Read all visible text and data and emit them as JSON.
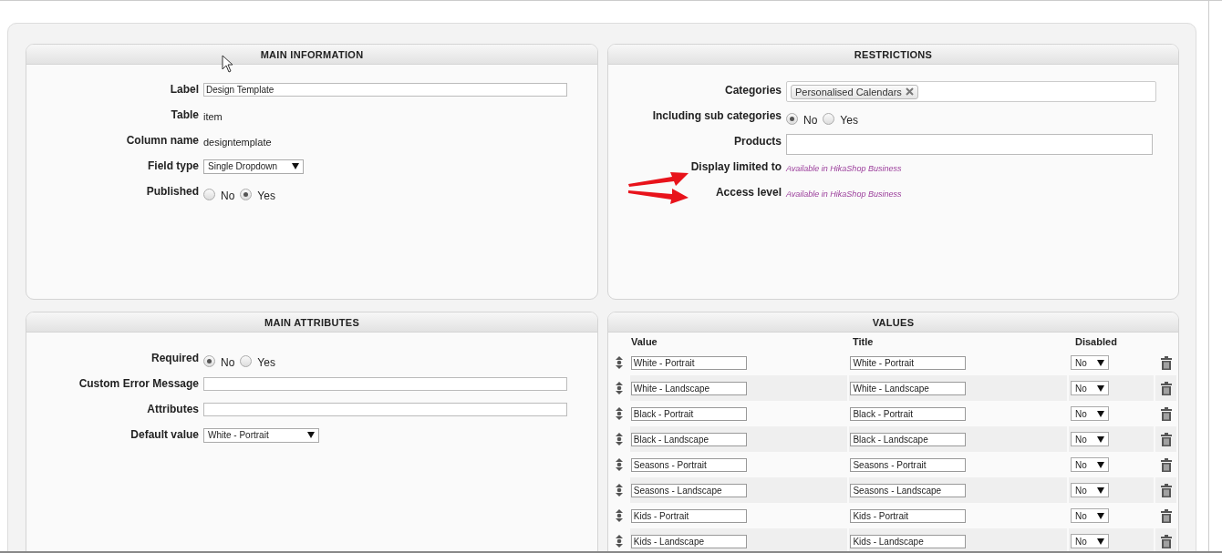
{
  "main_information": {
    "title": "MAIN INFORMATION",
    "fields": [
      {
        "kind": "input",
        "label": "Label",
        "value": "Design Template"
      },
      {
        "kind": "text",
        "label": "Table",
        "value": "item"
      },
      {
        "kind": "text",
        "label": "Column name",
        "value": "designtemplate"
      },
      {
        "kind": "select",
        "label": "Field type",
        "value": "Single Dropdown"
      },
      {
        "kind": "radio",
        "label": "Published",
        "options": [
          {
            "label": "No",
            "selected": false
          },
          {
            "label": "Yes",
            "selected": true
          }
        ]
      }
    ]
  },
  "restrictions": {
    "title": "RESTRICTIONS",
    "fields": [
      {
        "kind": "tags",
        "label": "Categories",
        "tags": [
          "Personalised Calendars"
        ]
      },
      {
        "kind": "radio",
        "label": "Including sub categories",
        "options": [
          {
            "label": "No",
            "selected": true
          },
          {
            "label": "Yes",
            "selected": false
          }
        ]
      },
      {
        "kind": "input",
        "label": "Products"
      },
      {
        "kind": "note",
        "label": "Display limited to",
        "value": "Available in HikaShop Business"
      },
      {
        "kind": "note",
        "label": "Access level",
        "value": "Available in HikaShop Business"
      }
    ]
  },
  "main_attributes": {
    "title": "MAIN ATTRIBUTES",
    "fields": [
      {
        "kind": "radio",
        "label": "Required",
        "options": [
          {
            "label": "No",
            "selected": true
          },
          {
            "label": "Yes",
            "selected": false
          }
        ]
      },
      {
        "kind": "input",
        "label": "Custom Error Message"
      },
      {
        "kind": "input",
        "label": "Attributes"
      },
      {
        "kind": "select",
        "label": "Default value",
        "value": "White - Portrait"
      }
    ]
  },
  "values": {
    "title": "VALUES",
    "columns": [
      "Value",
      "Title",
      "Disabled"
    ],
    "rows": [
      {
        "value": "White - Portrait",
        "title": "White - Portrait",
        "disabled": "No"
      },
      {
        "value": "White - Landscape",
        "title": "White - Landscape",
        "disabled": "No"
      },
      {
        "value": "Black - Portrait",
        "title": "Black - Portrait",
        "disabled": "No"
      },
      {
        "value": "Black - Landscape",
        "title": "Black - Landscape",
        "disabled": "No"
      },
      {
        "value": "Seasons - Portrait",
        "title": "Seasons - Portrait",
        "disabled": "No"
      },
      {
        "value": "Seasons - Landscape",
        "title": "Seasons - Landscape",
        "disabled": "No"
      },
      {
        "value": "Kids - Portrait",
        "title": "Kids - Portrait",
        "disabled": "No"
      },
      {
        "value": "Kids - Landscape",
        "title": "Kids - Landscape",
        "disabled": "No"
      }
    ]
  }
}
